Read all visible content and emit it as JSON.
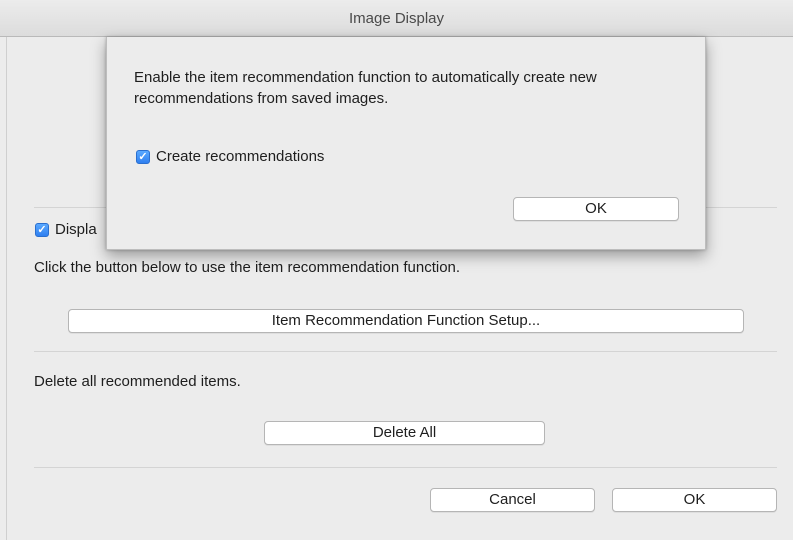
{
  "window": {
    "title": "Image Display"
  },
  "main": {
    "display_checkbox_label": "Displa",
    "display_checked": true,
    "instruction_text": "Click the button below to use the item recommendation function.",
    "setup_button_label": "Item Recommendation Function Setup...",
    "delete_text": "Delete all recommended items.",
    "delete_all_label": "Delete All",
    "cancel_label": "Cancel",
    "ok_label": "OK"
  },
  "sheet": {
    "message": "Enable the item recommendation function to automatically create new recommendations from saved images.",
    "create_checkbox_label": "Create recommendations",
    "create_checked": true,
    "ok_label": "OK"
  },
  "colors": {
    "checkbox_accent": "#3a8cf5",
    "window_background": "#ececec"
  }
}
